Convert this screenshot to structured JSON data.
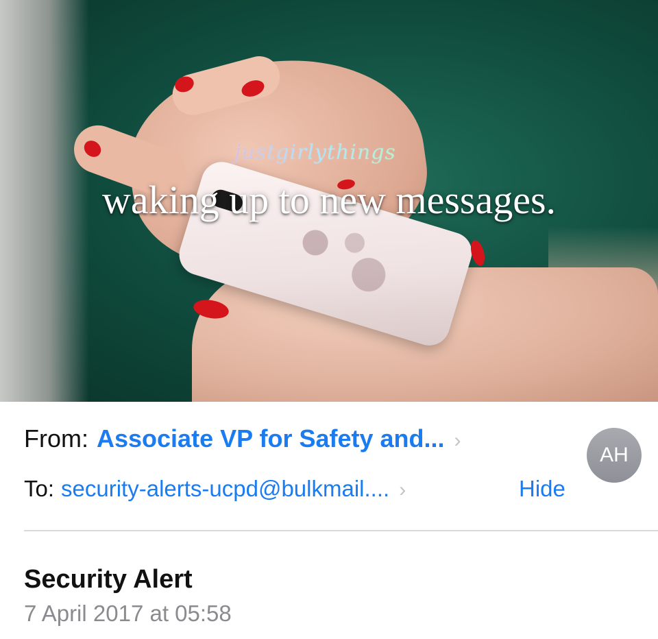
{
  "photo": {
    "brand": "justgirlythings",
    "caption": "waking up to new messages."
  },
  "email": {
    "from_label": "From:",
    "from_name": "Associate VP for Safety and...",
    "to_label": "To:",
    "to_address": "security-alerts-ucpd@bulkmail....",
    "hide_label": "Hide",
    "avatar_initials": "AH",
    "subject": "Security Alert",
    "date": "7 April 2017 at 05:58"
  },
  "colors": {
    "link_blue": "#1a7cf0",
    "nail_red": "#d4161c",
    "avatar_gray": "#9b9ca2"
  }
}
